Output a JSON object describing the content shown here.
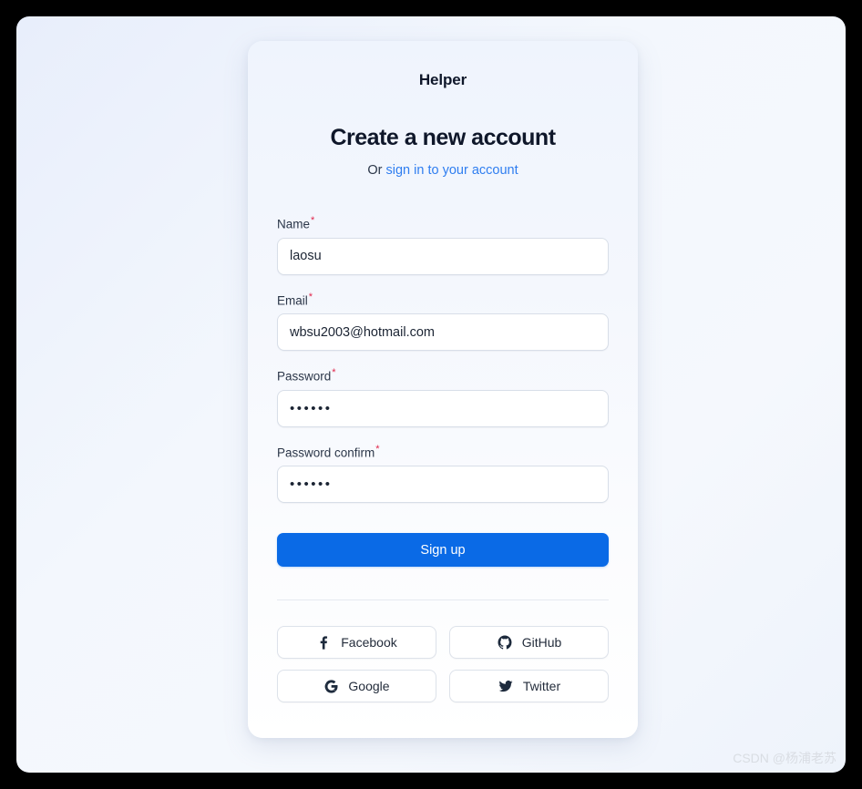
{
  "brand": {
    "name": "Helper"
  },
  "header": {
    "title": "Create a new account",
    "or_text": "Or ",
    "signin_link": "sign in to your account"
  },
  "form": {
    "required_marker": "*",
    "fields": [
      {
        "label": "Name",
        "value": "laosu",
        "placeholder": "",
        "required": true,
        "type": "text"
      },
      {
        "label": "Email",
        "value": "wbsu2003@hotmail.com",
        "placeholder": "",
        "required": true,
        "type": "text"
      },
      {
        "label": "Password",
        "value": "••••••",
        "placeholder": "",
        "required": true,
        "type": "password"
      },
      {
        "label": "Password confirm",
        "value": "••••••",
        "placeholder": "",
        "required": true,
        "type": "password"
      }
    ],
    "submit_label": "Sign up"
  },
  "social": {
    "buttons": [
      {
        "label": "Facebook",
        "icon": "facebook-icon"
      },
      {
        "label": "GitHub",
        "icon": "github-icon"
      },
      {
        "label": "Google",
        "icon": "google-icon"
      },
      {
        "label": "Twitter",
        "icon": "twitter-icon"
      }
    ]
  },
  "watermark": {
    "text": "CSDN @杨浦老苏"
  },
  "colors": {
    "accent": "#0a6ae6",
    "link": "#2f7ef0",
    "required": "#e0264b",
    "text": "#0f172a",
    "card_bg": "#f4f7fd",
    "page_bg": "#f2f6fc"
  }
}
